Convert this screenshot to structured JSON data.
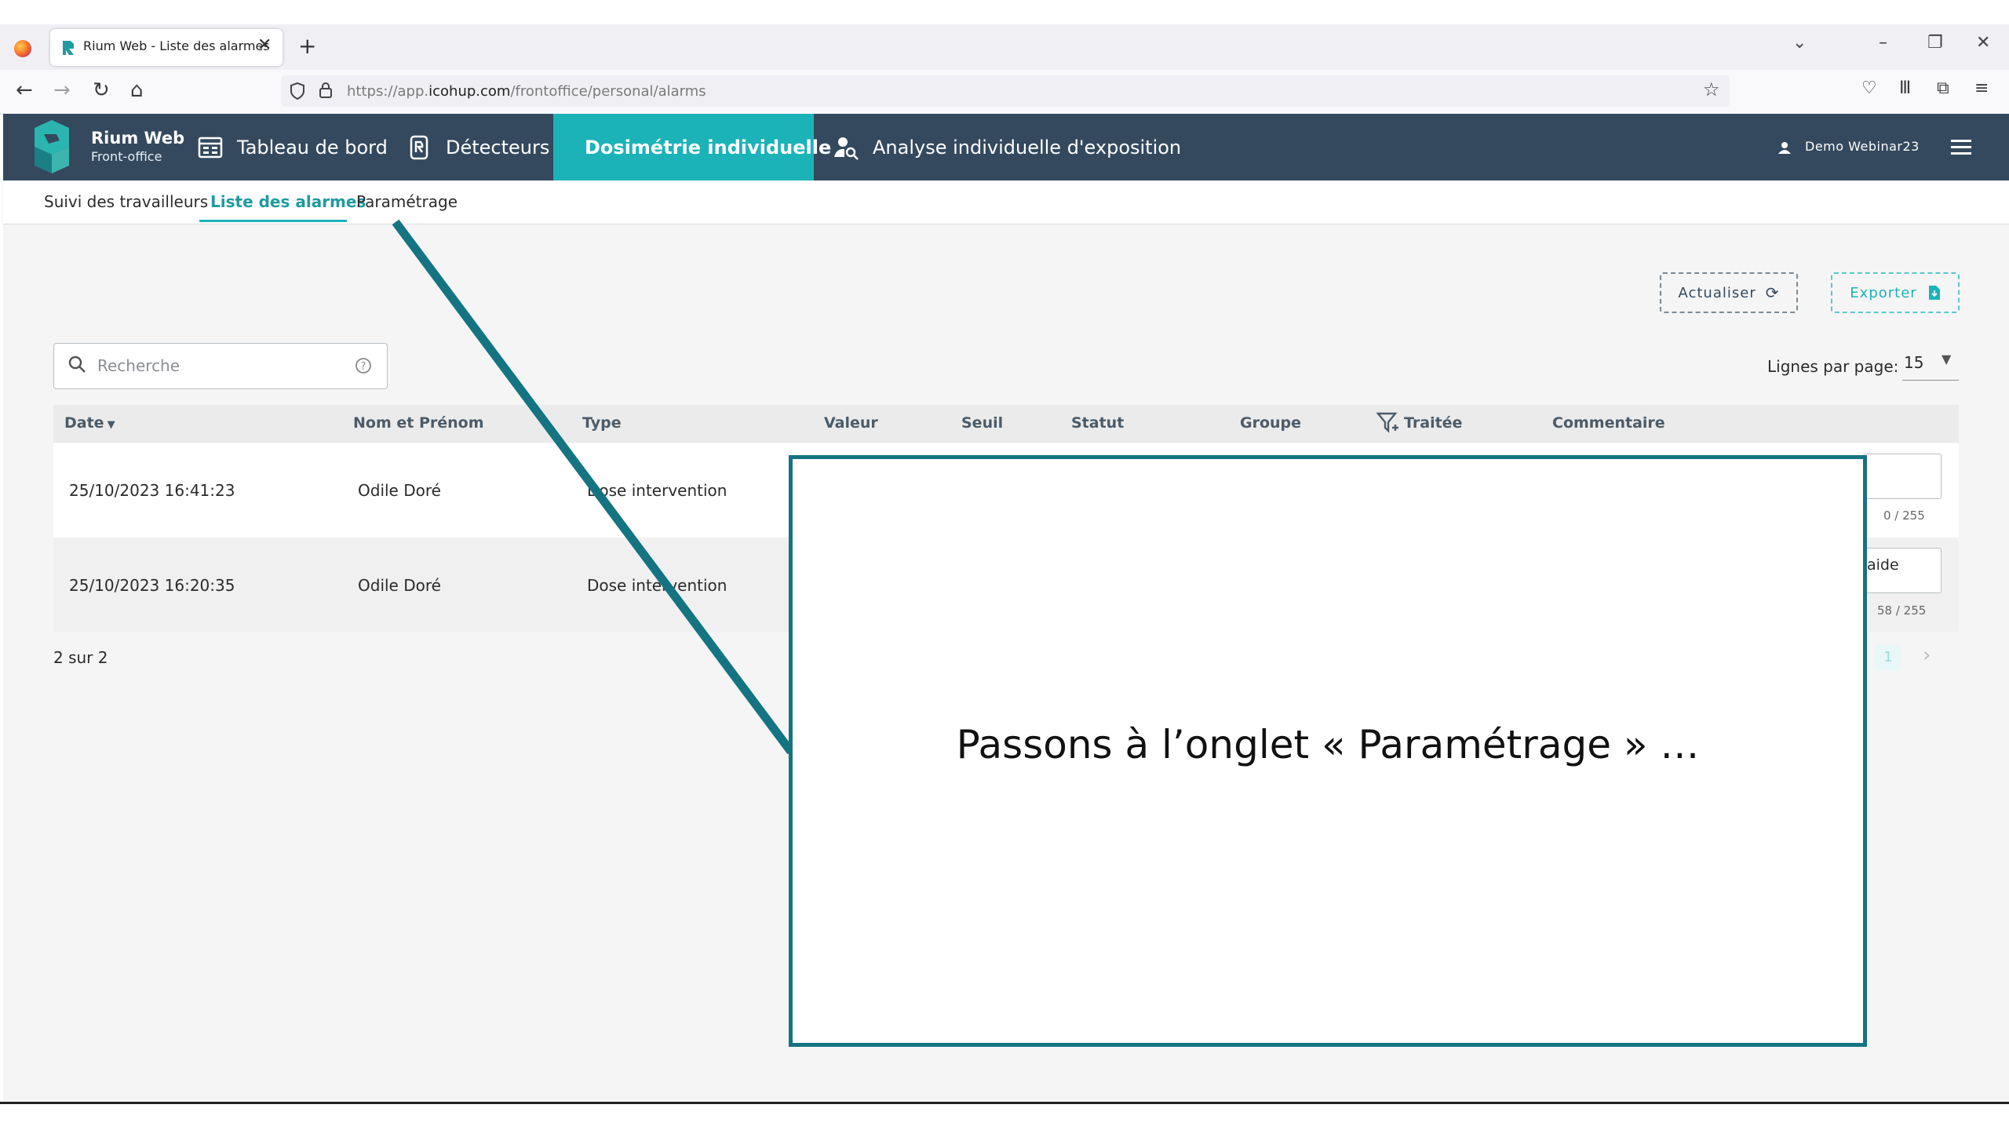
{
  "browser": {
    "tab_title": "Rium Web - Liste des alarmes",
    "url_prefix": "https://app.",
    "url_domain": "icohup.com",
    "url_path": "/frontoffice/personal/alarms"
  },
  "app": {
    "brand_name": "Rium Web",
    "brand_sub": "Front-office",
    "menu": [
      {
        "label": "Tableau de bord"
      },
      {
        "label": "Détecteurs"
      },
      {
        "label": "Dosimétrie individuelle"
      },
      {
        "label": "Analyse individuelle d'exposition"
      }
    ],
    "user": "Demo Webinar23"
  },
  "subnav": {
    "tabs": [
      {
        "label": "Suivi des travailleurs"
      },
      {
        "label": "Liste des alarmes"
      },
      {
        "label": "Paramétrage"
      }
    ]
  },
  "toolbar": {
    "refresh_label": "Actualiser",
    "export_label": "Exporter"
  },
  "search": {
    "placeholder": "Recherche"
  },
  "pagination": {
    "rows_label": "Lignes par page:",
    "rows_value": "15",
    "count_text": "2 sur 2",
    "current_page": "1"
  },
  "table": {
    "headers": {
      "date": "Date",
      "name": "Nom et Prénom",
      "type": "Type",
      "value": "Valeur",
      "threshold": "Seuil",
      "status": "Statut",
      "group": "Groupe",
      "treated": "Traitée",
      "comment": "Commentaire"
    },
    "rows": [
      {
        "date": "25/10/2023 16:41:23",
        "name": "Odile Doré",
        "type": "Dose intervention",
        "counter": "0 / 255",
        "comment": ""
      },
      {
        "date": "25/10/2023 16:20:35",
        "name": "Odile Doré",
        "type": "Dose intervention",
        "counter": "58 / 255",
        "comment": "aide"
      }
    ]
  },
  "annotation": {
    "text": "Passons à l’onglet « Paramétrage » …"
  },
  "colors": {
    "header_bg": "#34495e",
    "accent": "#1bb3b8",
    "callout_border": "#157482"
  }
}
